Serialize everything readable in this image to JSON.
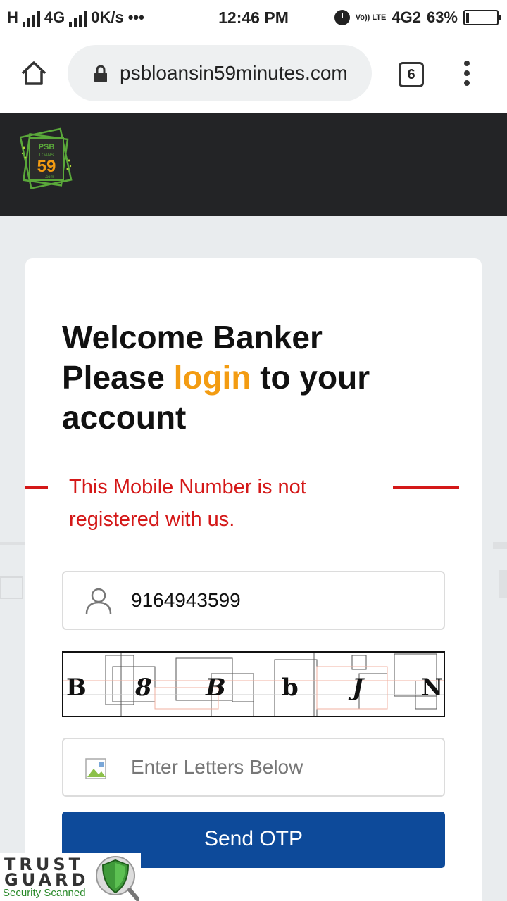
{
  "status_bar": {
    "network_h": "H",
    "network_4g": "4G",
    "speed": "0K/s",
    "more": "•••",
    "time": "12:46 PM",
    "volte": "Vo)) LTE",
    "network_4g2": "4G2",
    "battery": "63%"
  },
  "browser": {
    "url": "psbloansin59minutes.com",
    "tab_count": "6"
  },
  "logo": {
    "line1": "PSB",
    "line2": "LOANS",
    "number": "59",
    "suffix": ".com"
  },
  "login": {
    "heading_line1": "Welcome Banker",
    "heading_please": "Please ",
    "heading_highlight": "login",
    "heading_rest": " to your",
    "heading_line3": "account",
    "error": "This Mobile Number is not registered with us.",
    "mobile_value": "9164943599",
    "captcha_chars": [
      "B",
      "8",
      "B",
      "b",
      "J",
      "N"
    ],
    "letters_placeholder": "Enter Letters Below",
    "send_otp": "Send OTP"
  },
  "trust_guard": {
    "trust": "TRUST",
    "guard": "GUARD",
    "scanned": "Security Scanned"
  },
  "colors": {
    "highlight": "#f39c12",
    "error": "#d41818",
    "button": "#0d4a9a",
    "header": "#232426"
  }
}
